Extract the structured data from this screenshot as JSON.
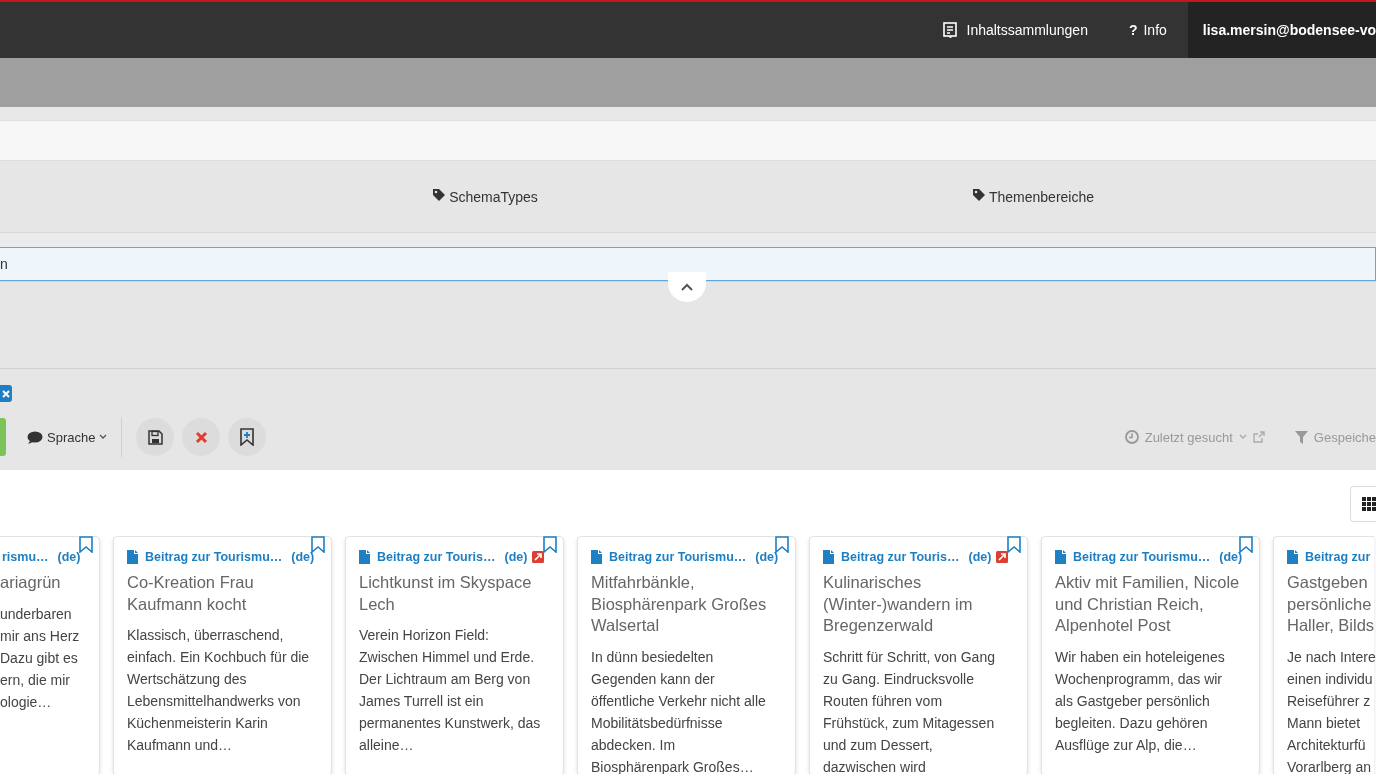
{
  "navbar": {
    "links": [
      {
        "kind": "collections",
        "label": "Inhaltssammlungen"
      },
      {
        "kind": "info",
        "icon": "?",
        "label": "Info"
      }
    ],
    "user": "lisa.mersin@bodensee-vo"
  },
  "filters": {
    "facets": [
      {
        "label": "SchemaTypes"
      },
      {
        "label": "Themenbereiche"
      }
    ],
    "search": {
      "value": "n"
    }
  },
  "toolbar": {
    "language": "Sprache",
    "actions": [
      {
        "kind": "save"
      },
      {
        "kind": "discard"
      },
      {
        "kind": "bookmark"
      }
    ],
    "recent": "Zuletzt gesucht",
    "saved": "Gespeiche"
  },
  "cards": [
    {
      "type": "rismu…",
      "lang": "(de)",
      "title": "ariagrün",
      "text": "underbaren\nmir ans Herz\nDazu gibt es\nern, die mir\nologie…"
    },
    {
      "type": "Beitrag zur Tourismu…",
      "lang": "(de)",
      "external": false,
      "title": "Co-Kreation Frau\nKaufmann kocht",
      "text": "Klassisch, überraschend,\neinfach. Ein Kochbuch für die\nWertschätzung des\nLebensmittelhandwerks von\nKüchenmeisterin Karin\nKaufmann und…"
    },
    {
      "type": "Beitrag zur Touris…",
      "lang": "(de)",
      "external": true,
      "title": "Lichtkunst im Skyspace\nLech",
      "text": "Verein Horizon Field:\nZwischen Himmel und Erde.\nDer Lichtraum am Berg von\nJames Turrell ist ein\npermanentes Kunstwerk, das\nalleine…"
    },
    {
      "type": "Beitrag zur Tourismu…",
      "lang": "(de)",
      "external": false,
      "title": "Mitfahrbänkle,\nBiosphärenpark Großes\nWalsertal",
      "text": "In dünn besiedelten\nGegenden kann der\nöffentliche Verkehr nicht alle\nMobilitätsbedürfnisse\nabdecken. Im\nBiosphärenpark Großes…"
    },
    {
      "type": "Beitrag zur Touris…",
      "lang": "(de)",
      "external": true,
      "title": "Kulinarisches\n(Winter-)wandern im\nBregenzerwald",
      "text": "Schritt für Schritt, von Gang\nzu Gang. Eindrucksvolle\nRouten führen vom\nFrühstück, zum Mitagessen\nund zum Dessert,\ndazwischen wird"
    },
    {
      "type": "Beitrag zur Tourismu…",
      "lang": "(de)",
      "external": false,
      "title": "Aktiv mit Familien, Nicole\nund Christian Reich,\nAlpenhotel Post",
      "text": "Wir haben ein hoteleigenes\nWochenprogramm, das wir\nals Gastgeber persönlich\nbegleiten. Dazu gehören\nAusflüge zur Alp, die…"
    },
    {
      "type": "Beitrag zur",
      "title": "Gastgeben\npersönliche\nHaller, Bilds",
      "text": "Je nach Intere\neinen individu\nReiseführer z\nMann bietet\nArchitekturfü\nVorarlberg an"
    }
  ]
}
